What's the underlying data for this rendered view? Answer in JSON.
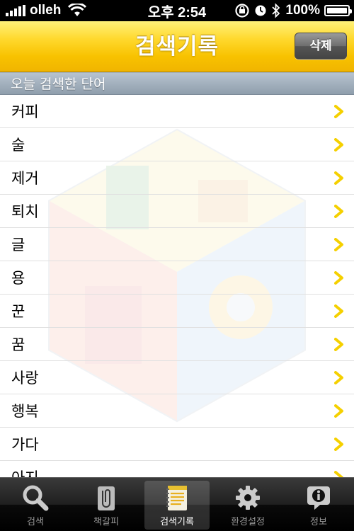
{
  "status_bar": {
    "carrier": "olleh",
    "time": "오후 2:54",
    "battery_text": "100%",
    "battery_level": 1.0
  },
  "nav": {
    "title": "검색기록",
    "delete_label": "삭제"
  },
  "section": {
    "header": "오늘 검색한 단어"
  },
  "list": {
    "items": [
      {
        "label": "커피"
      },
      {
        "label": "술"
      },
      {
        "label": "제거"
      },
      {
        "label": "퇴치"
      },
      {
        "label": "글"
      },
      {
        "label": "용"
      },
      {
        "label": "꾼"
      },
      {
        "label": "꿈"
      },
      {
        "label": "사랑"
      },
      {
        "label": "행복"
      },
      {
        "label": "가다"
      },
      {
        "label": "아지"
      }
    ]
  },
  "tabs": [
    {
      "label": "검색",
      "icon": "search-icon",
      "active": false
    },
    {
      "label": "책갈피",
      "icon": "paperclip-icon",
      "active": false
    },
    {
      "label": "검색기록",
      "icon": "notepad-icon",
      "active": true
    },
    {
      "label": "환경설정",
      "icon": "gear-icon",
      "active": false
    },
    {
      "label": "정보",
      "icon": "info-icon",
      "active": false
    }
  ],
  "colors": {
    "nav_yellow": "#f8c200",
    "chevron_yellow": "#f5d000",
    "section_gray": "#9aa8b6"
  }
}
